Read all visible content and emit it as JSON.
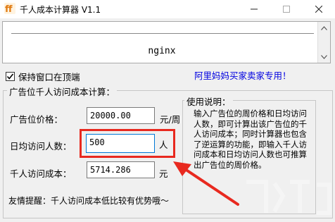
{
  "window": {
    "title": "千人成本计算器 V1.1",
    "controls": {
      "minimize": "—",
      "maximize": "☐",
      "close": "✕"
    }
  },
  "display": {
    "text": "nginx"
  },
  "options": {
    "keep_on_top_label": "保持窗口在顶端",
    "keep_on_top_checked": true,
    "link_text": "阿里妈妈买家卖家专用！"
  },
  "calculator": {
    "group_title": "广告位千人访问成本计算：",
    "price_label": "广告位价格：",
    "price_value": "20000.00",
    "price_unit": "元/周",
    "visits_label": "日均访问人数：",
    "visits_value": "500",
    "visits_unit": "人",
    "cost_label": "千人访问成本：",
    "cost_value": "5714.286",
    "cost_unit": "元"
  },
  "usage": {
    "title": "使用说明：",
    "text": "输入广告位的周价格和日均访问人数，即可计算出该广告位的千人访问成本；同时计算器也包含了逆运算的功能，即输入千人访问成本和日均访问人数也可推算出广告位的周价格。"
  },
  "tip": "友情提醒：千人访问成本低比较有优势哦～",
  "colors": {
    "highlight_box": "#e8291f",
    "link": "#0000e0",
    "focus_border": "#0078d7"
  }
}
